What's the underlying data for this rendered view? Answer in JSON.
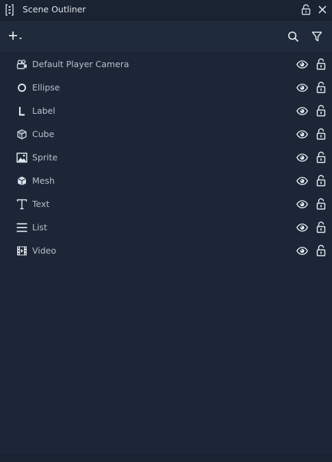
{
  "panel": {
    "title": "Scene Outliner"
  },
  "colors": {
    "background": "#1c2636",
    "titlebar": "#1a2332",
    "toolbar": "#1f2a3a",
    "text": "#b8c1cd",
    "icon": "#d8dee6"
  },
  "titlebar": {
    "icons": [
      "drag-handle-icon",
      "lock-icon",
      "close-icon"
    ]
  },
  "toolbar": {
    "icons": [
      "add-icon",
      "search-icon",
      "filter-icon"
    ]
  },
  "outliner": {
    "items": [
      {
        "label": "Default Player Camera",
        "icon": "camera-icon"
      },
      {
        "label": "Ellipse",
        "icon": "ellipse-icon"
      },
      {
        "label": "Label",
        "icon": "label-icon"
      },
      {
        "label": "Cube",
        "icon": "cube-icon"
      },
      {
        "label": "Sprite",
        "icon": "sprite-icon"
      },
      {
        "label": "Mesh",
        "icon": "mesh-icon"
      },
      {
        "label": "Text",
        "icon": "text-icon"
      },
      {
        "label": "List",
        "icon": "list-icon"
      },
      {
        "label": "Video",
        "icon": "video-icon"
      }
    ]
  }
}
